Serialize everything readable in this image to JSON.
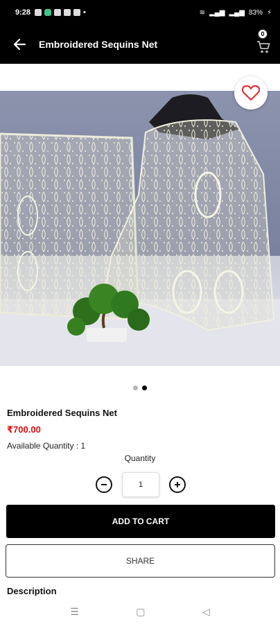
{
  "status_bar": {
    "time": "9:28",
    "right_text": "83%"
  },
  "app_bar": {
    "title": "Embroidered Sequins Net",
    "cart_count": "0",
    "back_icon": "arrow-left-icon",
    "cart_icon": "cart-icon"
  },
  "carousel": {
    "favorite_icon": "heart-outline-icon",
    "page_count": 2,
    "active_page": 2
  },
  "product": {
    "name": "Embroidered Sequins Net",
    "price": "₹700.00",
    "available_label": "Available Quantity : ",
    "available_value": "1",
    "quantity_label": "Quantity",
    "quantity_value": "1"
  },
  "actions": {
    "add_to_cart": "ADD TO CART",
    "share": "SHARE"
  },
  "description": {
    "title": "Description"
  },
  "colors": {
    "price_red": "#e10a0a",
    "primary_black": "#000000",
    "favorite_red": "#e0303a"
  }
}
